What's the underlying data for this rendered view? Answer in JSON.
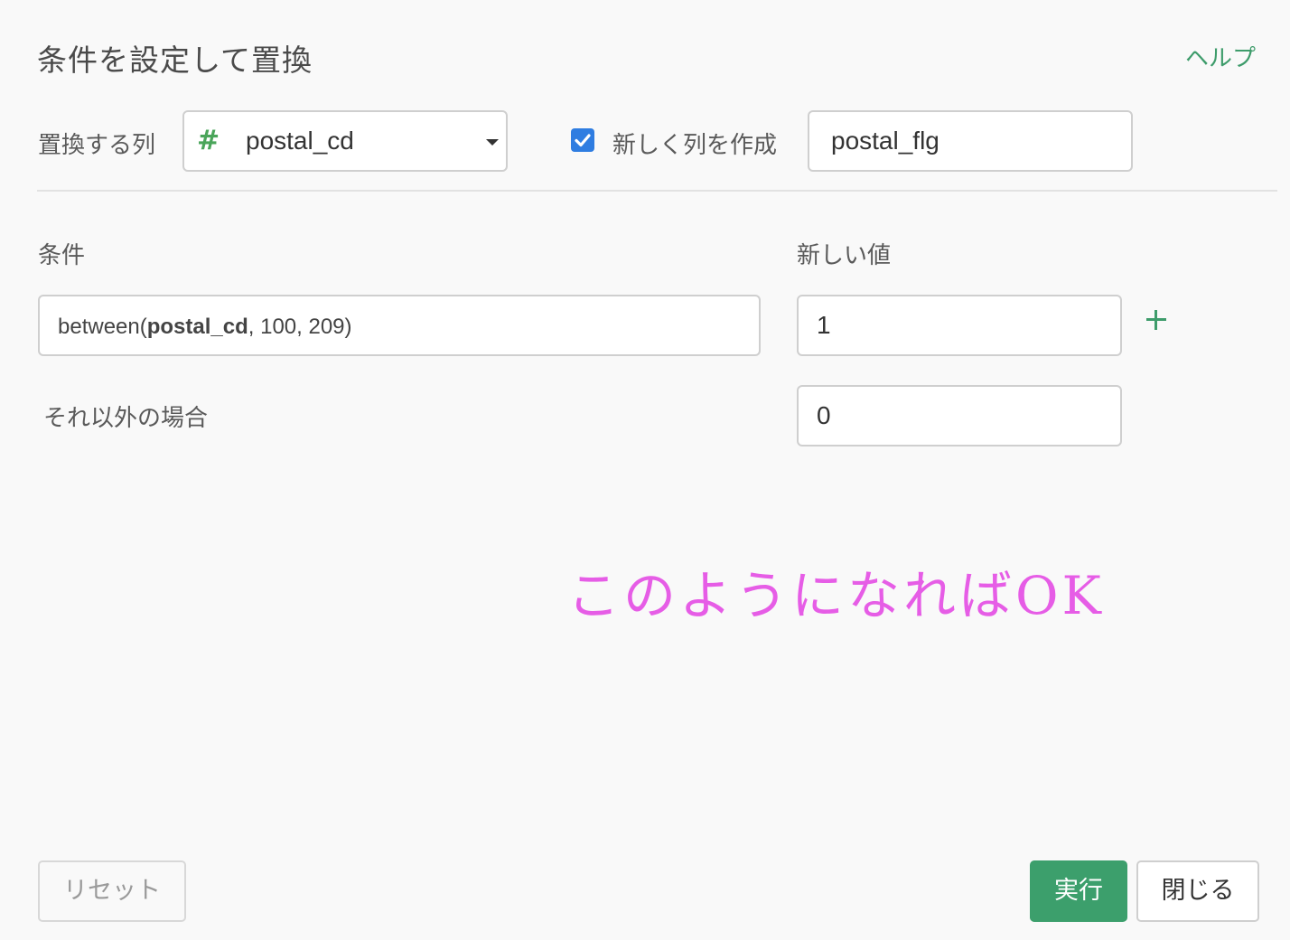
{
  "dialog": {
    "title": "条件を設定して置換",
    "help_label": "ヘルプ"
  },
  "replace_column": {
    "label": "置換する列",
    "type_icon": "#",
    "selected": "postal_cd"
  },
  "new_column": {
    "checkbox_checked": true,
    "label": "新しく列を作成",
    "value": "postal_flg"
  },
  "headers": {
    "condition": "条件",
    "new_value": "新しい値"
  },
  "rules": [
    {
      "condition_prefix": "between(",
      "condition_column": "postal_cd",
      "condition_suffix": ", 100, 209)",
      "value": "1"
    }
  ],
  "otherwise": {
    "label": "それ以外の場合",
    "value": "0"
  },
  "annotation": "このようになればOK",
  "buttons": {
    "reset": "リセット",
    "run": "実行",
    "close": "閉じる"
  },
  "colors": {
    "accent_green": "#3c9f6c",
    "checkbox_blue": "#2f7de1",
    "annotation_pink": "#e65de6"
  }
}
